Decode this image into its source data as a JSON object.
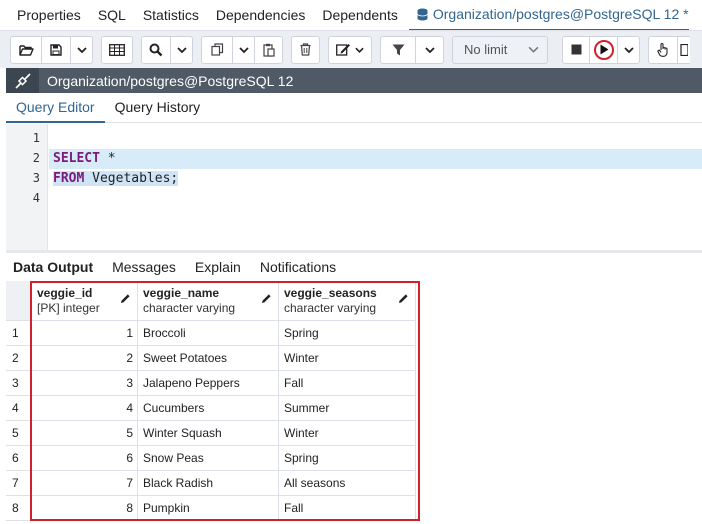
{
  "top_tabs": [
    "Properties",
    "SQL",
    "Statistics",
    "Dependencies",
    "Dependents"
  ],
  "active_tab": "Organization/postgres@PostgreSQL 12 *",
  "toolbar": {
    "limit_label": "No limit"
  },
  "connection": "Organization/postgres@PostgreSQL 12",
  "editor_tabs": [
    "Query Editor",
    "Query History"
  ],
  "editor": {
    "line_numbers": [
      "1",
      "2",
      "3",
      "4"
    ],
    "line2_kw": "SELECT",
    "line2_rest": " *",
    "line3_kw": "FROM",
    "line3_rest": " Vegetables;"
  },
  "output_tabs": [
    "Data Output",
    "Messages",
    "Explain",
    "Notifications"
  ],
  "table": {
    "columns": [
      {
        "name": "veggie_id",
        "type": "[PK] integer"
      },
      {
        "name": "veggie_name",
        "type": "character varying"
      },
      {
        "name": "veggie_seasons",
        "type": "character varying"
      }
    ],
    "rows": [
      [
        "1",
        "1",
        "Broccoli",
        "Spring"
      ],
      [
        "2",
        "2",
        "Sweet Potatoes",
        "Winter"
      ],
      [
        "3",
        "3",
        "Jalapeno Peppers",
        "Fall"
      ],
      [
        "4",
        "4",
        "Cucumbers",
        "Summer"
      ],
      [
        "5",
        "5",
        "Winter Squash",
        "Winter"
      ],
      [
        "6",
        "6",
        "Snow Peas",
        "Spring"
      ],
      [
        "7",
        "7",
        "Black Radish",
        "All seasons"
      ],
      [
        "8",
        "8",
        "Pumpkin",
        "Fall"
      ]
    ]
  },
  "colors": {
    "accent": "#326690",
    "highlight": "#d0202c",
    "connection_bar": "#4f5a66"
  }
}
